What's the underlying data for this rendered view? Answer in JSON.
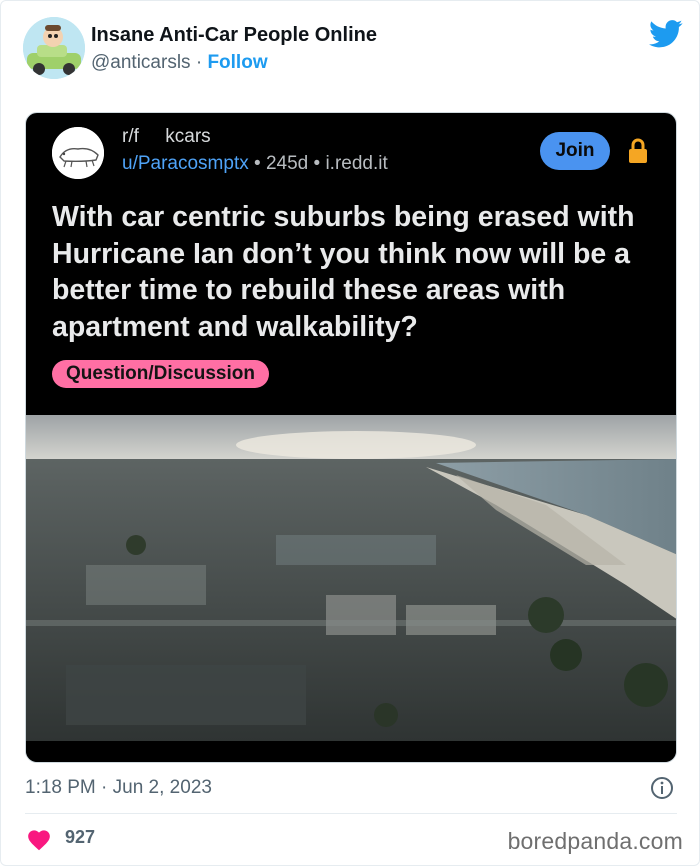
{
  "author": {
    "name": "Insane Anti-Car People Online",
    "handle": "@anticarsls",
    "separator": "·",
    "follow_label": "Follow"
  },
  "reddit_post": {
    "subreddit": "r/f     kcars",
    "username": "u/Paracosmptx",
    "age": "245d",
    "source": "i.redd.it",
    "bullet": "•",
    "join_label": "Join",
    "title": "With car centric suburbs being erased with Hurricane Ian don’t you think now will be a better time to rebuild these areas with apartment and walkability?",
    "flair": "Question/Discussion"
  },
  "footer": {
    "timestamp": "1:18 PM · Jun 2, 2023",
    "like_count": "927",
    "watermark": "boredpanda.com"
  },
  "colors": {
    "twitter_blue": "#1d9bf0",
    "join_button": "#4a93f0",
    "flair_pink": "#ff6fa4",
    "like_heart": "#f91880",
    "lock": "#f5a623"
  }
}
